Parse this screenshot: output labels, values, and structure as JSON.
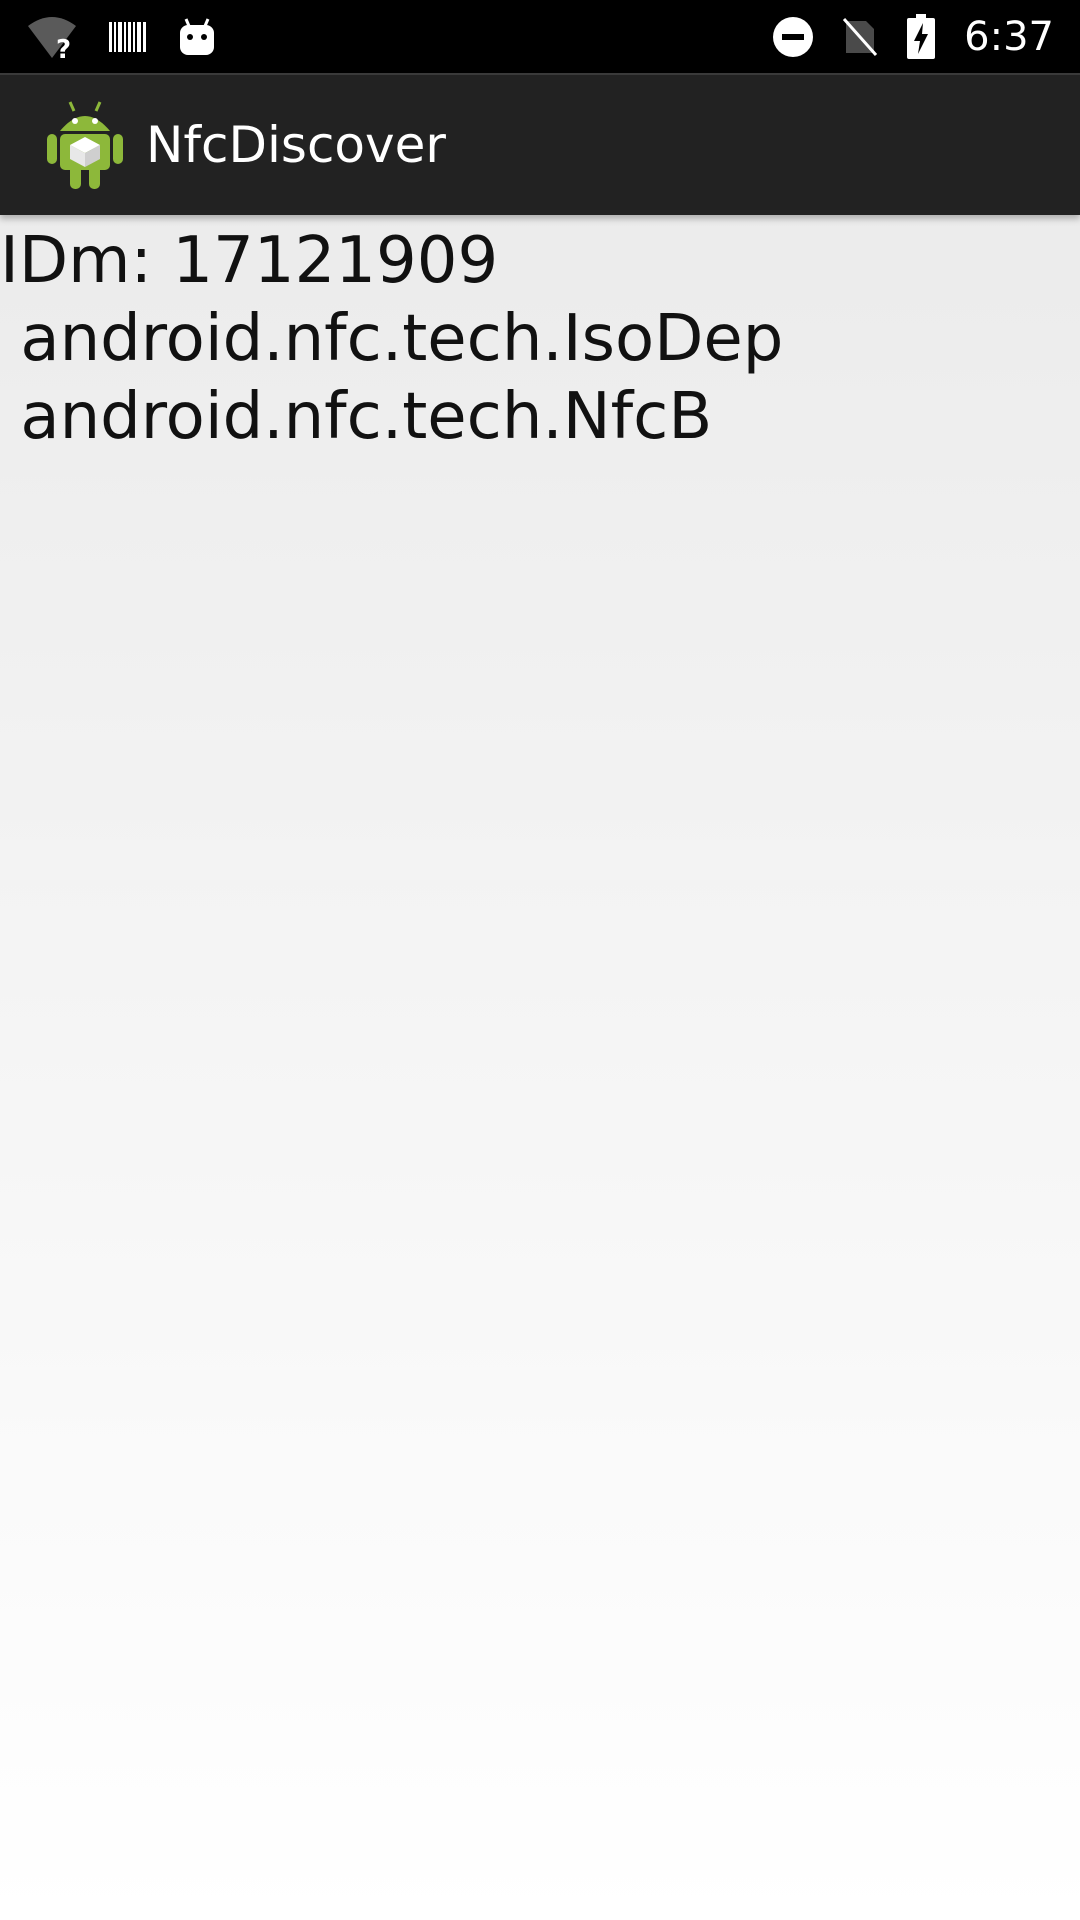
{
  "status_bar": {
    "time": "6:37",
    "left_icons": [
      "wifi-question-icon",
      "barcode-icon",
      "android-head-icon"
    ],
    "right_icons": [
      "do-not-disturb-icon",
      "no-sim-icon",
      "battery-charging-icon"
    ]
  },
  "action_bar": {
    "app_icon": "android-app-icon",
    "title": "NfcDiscover"
  },
  "content": {
    "lines": [
      "IDm: 17121909",
      " android.nfc.tech.IsoDep",
      " android.nfc.tech.NfcB"
    ]
  },
  "colors": {
    "status_bar_bg": "#000000",
    "action_bar_bg": "#222222",
    "android_green": "#8DB83A"
  }
}
